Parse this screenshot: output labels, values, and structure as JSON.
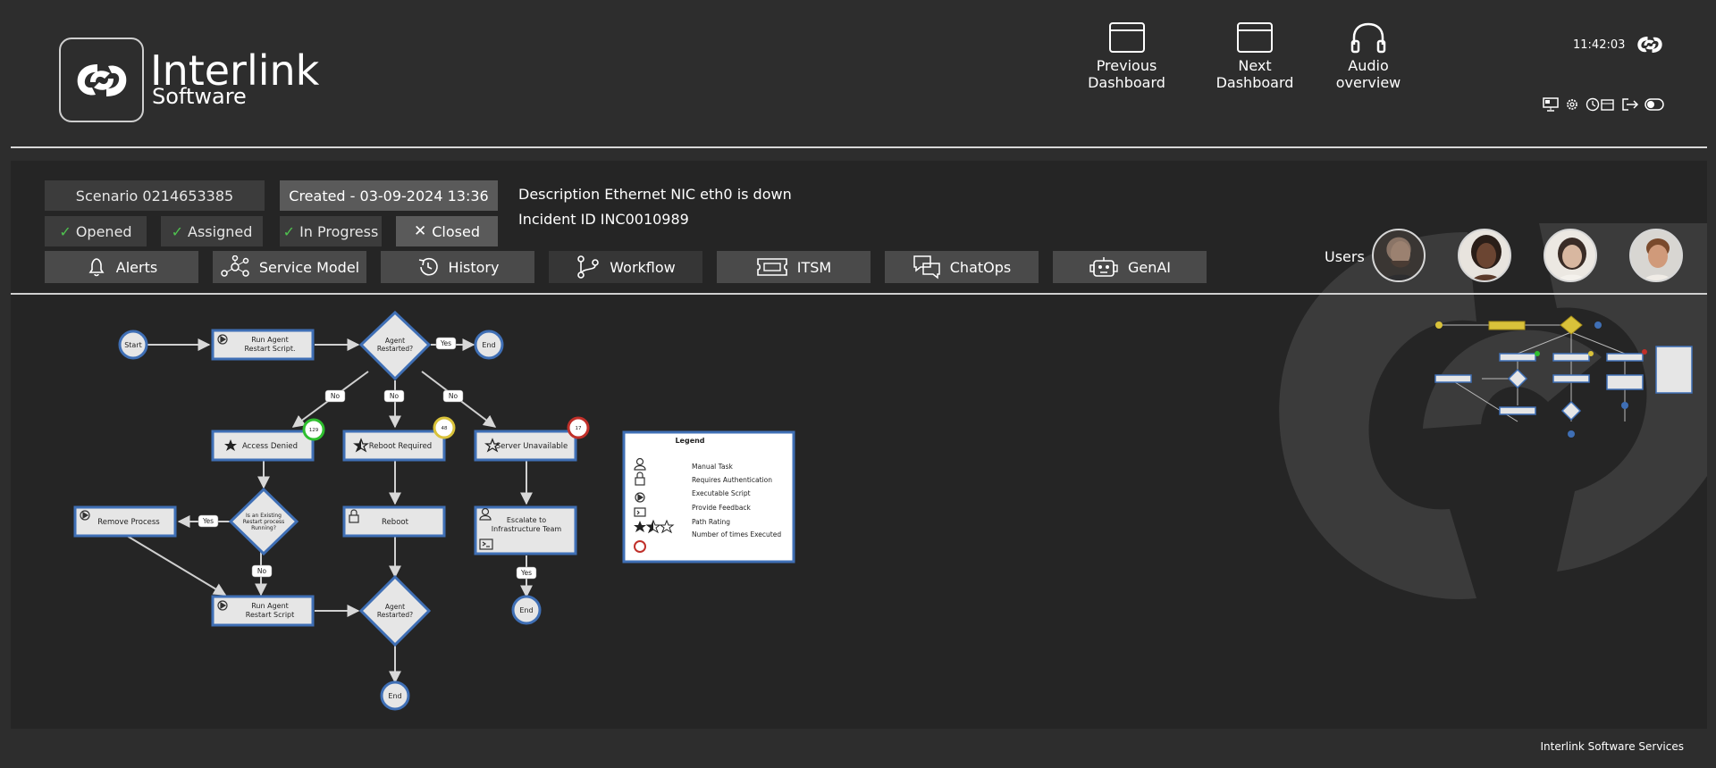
{
  "brand": {
    "name": "Interlink",
    "sub": "Software"
  },
  "nav": [
    {
      "label": "Previous Dashboard",
      "icon": "window-icon"
    },
    {
      "label": "Next Dashboard",
      "icon": "window-icon"
    },
    {
      "label": "Audio overview",
      "icon": "headphones-icon"
    }
  ],
  "clock": "11:42:03",
  "scenario": {
    "id_label": "Scenario 0214653385",
    "created": "Created - 03-09-2024 13:36",
    "description": "Description Ethernet NIC eth0 is down",
    "incident": "Incident ID INC0010989",
    "statuses": [
      {
        "label": "Opened",
        "state": "done"
      },
      {
        "label": "Assigned",
        "state": "done"
      },
      {
        "label": "In Progress",
        "state": "done"
      },
      {
        "label": "Closed",
        "state": "x"
      }
    ]
  },
  "tabs": [
    {
      "label": "Alerts",
      "icon": "bell-icon"
    },
    {
      "label": "Service Model",
      "icon": "network-icon"
    },
    {
      "label": "History",
      "icon": "history-icon"
    },
    {
      "label": "Workflow",
      "icon": "workflow-icon"
    },
    {
      "label": "ITSM",
      "icon": "ticket-icon"
    },
    {
      "label": "ChatOps",
      "icon": "chat-icon"
    },
    {
      "label": "GenAI",
      "icon": "robot-icon"
    }
  ],
  "users_label": "Users",
  "workflow": {
    "start": "Start",
    "end": "End",
    "yes": "Yes",
    "no": "No",
    "run_agent_1": [
      "Run Agent",
      "Restart Script."
    ],
    "run_agent_2": [
      "Run Agent",
      "Restart Script"
    ],
    "agent_restarted": [
      "Agent",
      "Restarted?"
    ],
    "access_denied": "Access Denied",
    "reboot_required": "Reboot Required",
    "server_unavailable": "Server Unavailable",
    "remove_process": "Remove Process",
    "existing_process": [
      "Is an Existing",
      "Restart process",
      "Running?"
    ],
    "reboot": "Reboot",
    "escalate": [
      "Escalate to",
      "Infrastructure Team"
    ],
    "counts": {
      "access_denied": "129",
      "reboot_required": "48",
      "server_unavailable": "17"
    }
  },
  "legend": {
    "title": "Legend",
    "items": [
      "Manual Task",
      "Requires Authentication",
      "Executable Script",
      "Provide Feedback",
      "Path Rating",
      "Number of times Executed"
    ]
  },
  "colors": {
    "accent_blue": "#3f6fb5",
    "green": "#2fbf2f",
    "yellow": "#d9c23a",
    "red": "#c0302a"
  },
  "footer": "Interlink Software Services"
}
